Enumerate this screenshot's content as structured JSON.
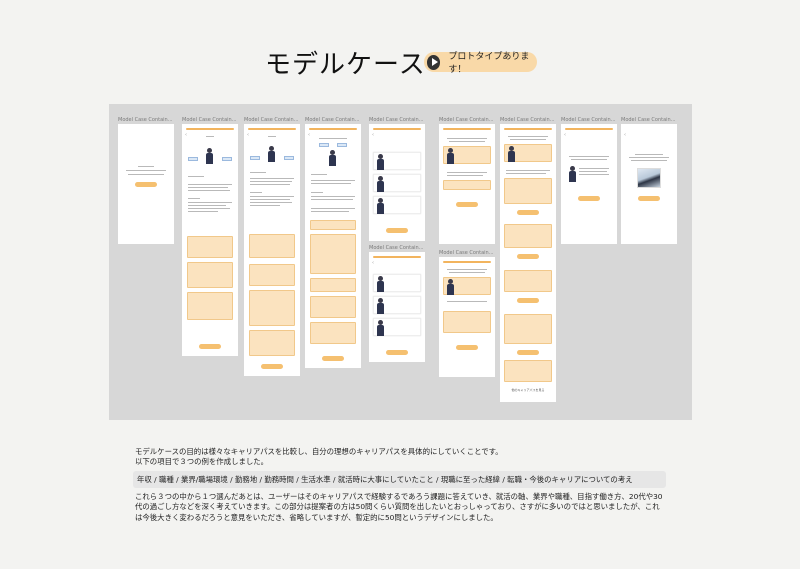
{
  "page": {
    "title": "モデルケース",
    "prototype_button": "プロトタイプあります！"
  },
  "frames": {
    "label": "Model Case Contain..."
  },
  "screen_text": {
    "more_link": "他のキャリアパスを見る"
  },
  "description": {
    "line1": "モデルケースの目的は様々なキャリアパスを比較し、自分の理想のキャリアパスを具体的にしていくことです。",
    "line2": "以下の項目で３つの例を作成しました。",
    "categories": "年収 / 職種 / 業界/職場環境 / 勤務地 / 勤務時間 / 生活水準 / 就活時に大事にしていたこと / 現職に至った経緯 / 転職・今後のキャリアについての考え",
    "body": "これら３つの中から１つ選んだあとは、ユーザーはそのキャリアパスで経験するであろう課題に答えていき、就活の軸、業界や職種、目指す働き方、20代や30代の過ごし方などを深く考えていきます。この部分は提案者の方は50問くらい質問を出したいとおっしゃっており、さすがに多いのではと思いましたが、これは今後大きく変わるだろうと意見をいただき、省略していますが、暫定的に50問というデザインにしました。"
  },
  "colors": {
    "accent": "#f5c070",
    "accent_light": "#fbe3bf",
    "canvas": "#d7d7d7",
    "badge": "#f9d9a8"
  }
}
